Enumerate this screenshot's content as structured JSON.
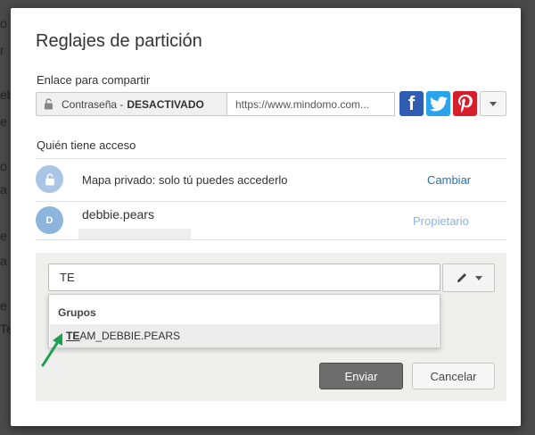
{
  "backdrop": {
    "fragments": [
      "o",
      "r",
      "ebb",
      "e",
      "o",
      "a",
      "e",
      "a",
      "e",
      "Te"
    ]
  },
  "dialog": {
    "title": "Reglajes de partición",
    "share": {
      "section_label": "Enlace para compartir",
      "password_label": "Contraseña -",
      "password_state": "DESACTIVADO",
      "url": "https://www.mindomo.com...",
      "social": [
        {
          "name": "facebook",
          "glyph": "f",
          "color": "#2f5db3"
        },
        {
          "name": "twitter",
          "glyph": "twitter-bird",
          "color": "#2aa3ee"
        },
        {
          "name": "pinterest",
          "glyph": "pinterest-p",
          "color": "#d71e2b"
        }
      ]
    },
    "access": {
      "section_label": "Quién tiene acceso",
      "private_text": "Mapa privado: solo tú puedes accederlo",
      "change_link": "Cambiar",
      "user": {
        "avatar_letter": "D",
        "name": "debbie.pears",
        "role": "Propietario"
      }
    },
    "invite": {
      "input_value": "TE",
      "dropdown": {
        "header": "Grupos",
        "item_match": "TE",
        "item_rest": "AM_DEBBIE.PEARS"
      },
      "send_label": "Enviar",
      "cancel_label": "Cancelar"
    }
  },
  "colors": {
    "accent_link": "#2a6fb0",
    "role_link": "#8ab4e0",
    "arrow": "#1e9e50"
  }
}
